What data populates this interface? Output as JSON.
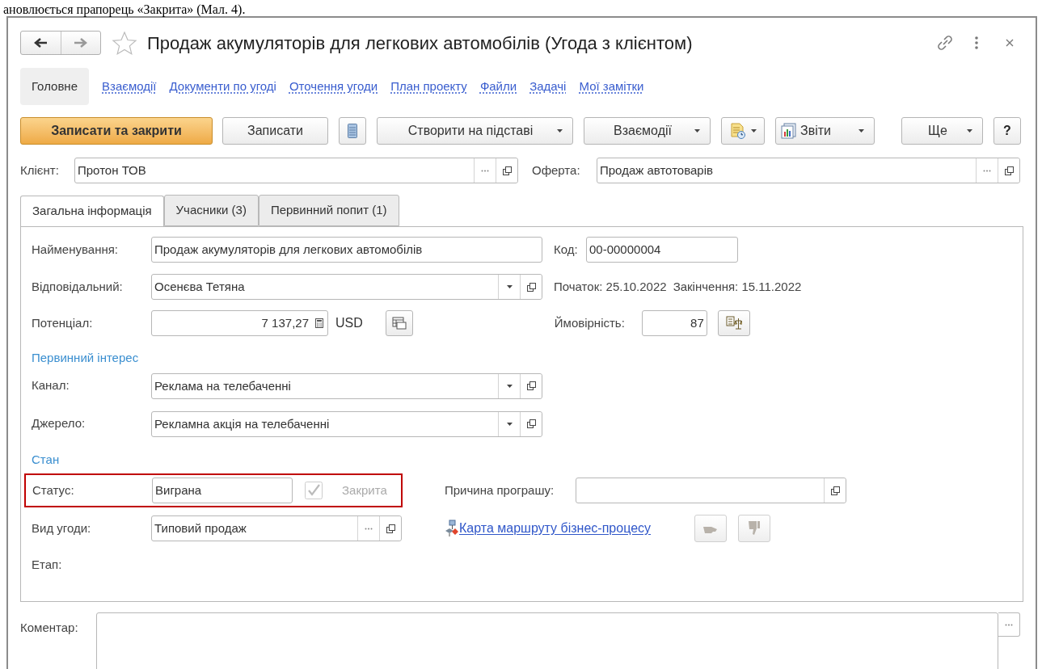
{
  "caption": "ановлюється прапорець «Закрита» (Мал. 4).",
  "window": {
    "title": "Продаж акумуляторів для легкових автомобілів (Угода з клієнтом)",
    "favorite": false
  },
  "sections": [
    {
      "label": "Головне",
      "selected": true
    },
    {
      "label": "Взаємодії",
      "selected": false
    },
    {
      "label": "Документи по угоді",
      "selected": false
    },
    {
      "label": "Оточення угоди",
      "selected": false
    },
    {
      "label": "План проекту",
      "selected": false
    },
    {
      "label": "Файли",
      "selected": false
    },
    {
      "label": "Задачі",
      "selected": false
    },
    {
      "label": "Мої замітки",
      "selected": false
    }
  ],
  "toolbar": [
    {
      "kind": "primary",
      "label": "Записати та закрити",
      "dropdown": false
    },
    {
      "kind": "plain",
      "label": "Записати",
      "dropdown": false
    },
    {
      "kind": "icon",
      "dropdown": false
    },
    {
      "kind": "plain",
      "label": "Створити на підставі",
      "dropdown": true
    },
    {
      "kind": "plain",
      "label": "Взаємодії",
      "dropdown": true
    },
    {
      "kind": "icon",
      "dropdown": true
    },
    {
      "kind": "icon-label",
      "label": "Звіти",
      "dropdown": true
    },
    {
      "kind": "plain",
      "label": "Ще",
      "dropdown": true
    },
    {
      "kind": "help",
      "label": "?",
      "dropdown": false
    }
  ],
  "client": {
    "label": "Клієнт:",
    "value": "Протон ТОВ"
  },
  "offer": {
    "label": "Оферта:",
    "value": "Продаж автотоварів"
  },
  "tabs": [
    {
      "label": "Загальна інформація",
      "selected": true
    },
    {
      "label": "Учасники (3)",
      "selected": false
    },
    {
      "label": "Первинний попит (1)",
      "selected": false
    }
  ],
  "general": {
    "name": {
      "label": "Найменування:",
      "value": "Продаж акумуляторів для легкових автомобілів"
    },
    "code": {
      "label": "Код:",
      "value": "00-00000004"
    },
    "responsible": {
      "label": "Відповідальний:",
      "value": "Осенєва Тетяна"
    },
    "start": "Початок: 25.10.2022",
    "end": "Закінчення: 15.11.2022",
    "potential": {
      "label": "Потенціал:",
      "value": "7 137,27",
      "currency": "USD"
    },
    "probability": {
      "label": "Ймовірність:",
      "value": "87"
    }
  },
  "primary_interest": {
    "heading": "Первинний інтерес",
    "channel": {
      "label": "Канал:",
      "value": "Реклама на телебаченні"
    },
    "source": {
      "label": "Джерело:",
      "value": "Рекламна акція на телебаченні"
    }
  },
  "state": {
    "heading": "Стан",
    "status": {
      "label": "Статус:",
      "value": "Виграна",
      "highlighted": true
    },
    "closed": {
      "label": "Закрита",
      "checked": true,
      "disabled": true
    },
    "loss_reason": {
      "label": "Причина програшу:"
    },
    "deal_type": {
      "label": "Вид угоди:",
      "value": "Типовий продаж"
    },
    "route_link": "Карта маршруту бізнес-процесу",
    "stage": {
      "label": "Етап:"
    }
  },
  "comment": {
    "label": "Коментар:"
  }
}
